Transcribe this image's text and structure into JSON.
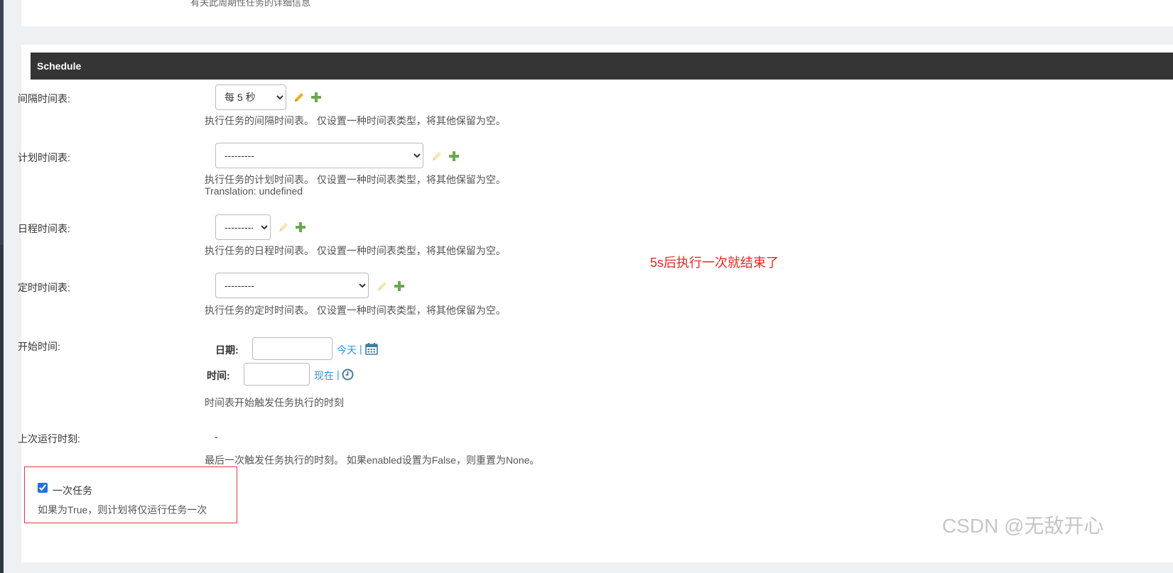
{
  "top_help": "有关此周期性任务的详细信息",
  "module": {
    "title": "Schedule"
  },
  "fields": {
    "interval": {
      "label": "间隔时间表:",
      "selected": "每 5 秒",
      "help": "执行任务的间隔时间表。 仅设置一种时间表类型，将其他保留为空。"
    },
    "crontab": {
      "label": "计划时间表:",
      "selected": "---------",
      "help": "执行任务的计划时间表。 仅设置一种时间表类型，将其他保留为空。",
      "help2": "Translation: undefined"
    },
    "solar": {
      "label": "日程时间表:",
      "selected": "---------",
      "help": "执行任务的日程时间表。 仅设置一种时间表类型，将其他保留为空。"
    },
    "clocked": {
      "label": "定时时间表:",
      "selected": "---------",
      "help": "执行任务的定时时间表。 仅设置一种时间表类型，将其他保留为空。"
    },
    "start_time": {
      "label": "开始时间:",
      "date_label": "日期:",
      "date_value": "",
      "today_link": "今天",
      "time_label": "时间:",
      "time_value": "",
      "now_link": "现在",
      "separator": "|",
      "help": "时间表开始触发任务执行的时刻"
    },
    "last_run": {
      "label": "上次运行时刻:",
      "value": "-",
      "help": "最后一次触发任务执行的时刻。 如果enabled设置为False，则重置为None。"
    },
    "one_off": {
      "label": "一次任务",
      "checked": true,
      "help": "如果为True，则计划将仅运行任务一次"
    }
  },
  "annotation": "5s后执行一次就结束了",
  "watermark": "CSDN @无敌开心",
  "colors": {
    "header_bg": "#353535",
    "link": "#3a8fd6",
    "edit_icon": "#e8b520",
    "add_icon": "#6aa84f",
    "annotation": "#e8261e",
    "highlight_border": "#e03a3a"
  }
}
